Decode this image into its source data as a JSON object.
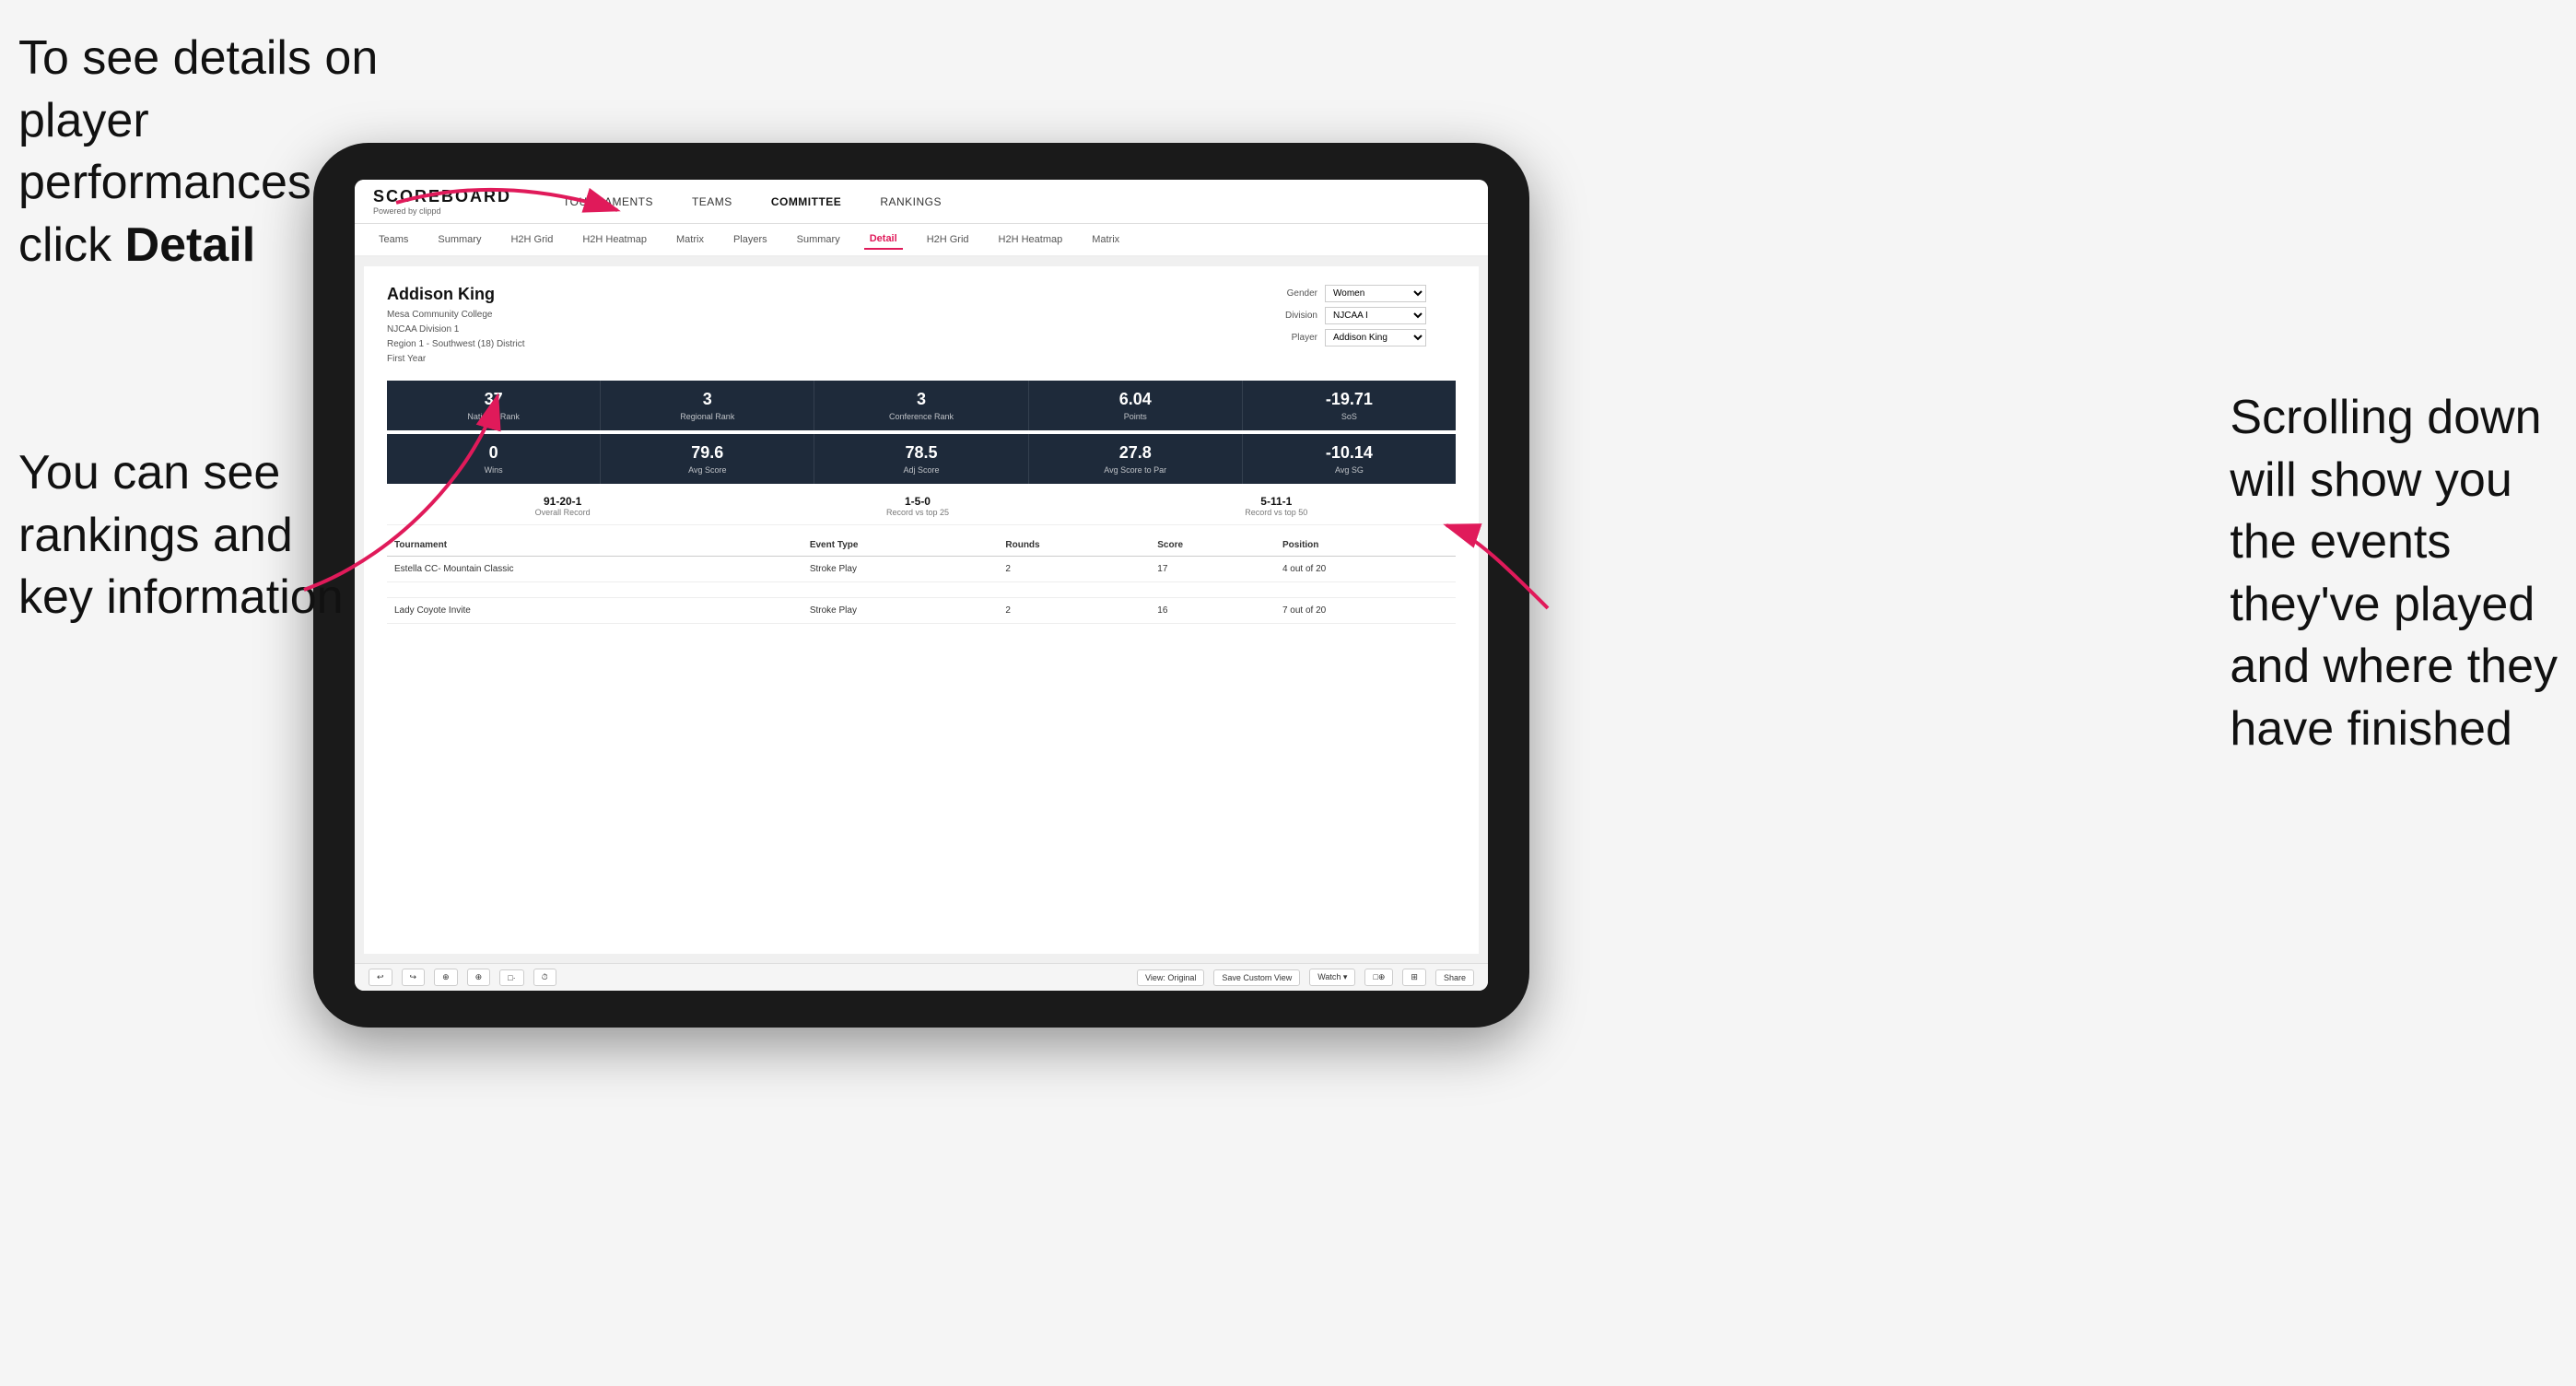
{
  "annotations": {
    "top_left": "To see details on player performances click ",
    "top_left_bold": "Detail",
    "bottom_left_line1": "You can see",
    "bottom_left_line2": "rankings and",
    "bottom_left_line3": "key information",
    "right_line1": "Scrolling down",
    "right_line2": "will show you",
    "right_line3": "the events",
    "right_line4": "they've played",
    "right_line5": "and where they",
    "right_line6": "have finished"
  },
  "nav": {
    "logo": "SCOREBOARD",
    "logo_sub": "Powered by clippd",
    "links": [
      "TOURNAMENTS",
      "TEAMS",
      "COMMITTEE",
      "RANKINGS"
    ]
  },
  "sub_nav": {
    "links": [
      "Teams",
      "Summary",
      "H2H Grid",
      "H2H Heatmap",
      "Matrix",
      "Players",
      "Summary",
      "Detail",
      "H2H Grid",
      "H2H Heatmap",
      "Matrix"
    ],
    "active": "Detail"
  },
  "player": {
    "name": "Addison King",
    "school": "Mesa Community College",
    "division": "NJCAA Division 1",
    "region": "Region 1 - Southwest (18) District",
    "year": "First Year"
  },
  "filters": {
    "gender_label": "Gender",
    "gender_value": "Women",
    "division_label": "Division",
    "division_value": "NJCAA I",
    "player_label": "Player",
    "player_value": "Addison King"
  },
  "stats_row1": [
    {
      "value": "37",
      "label": "National Rank"
    },
    {
      "value": "3",
      "label": "Regional Rank"
    },
    {
      "value": "3",
      "label": "Conference Rank"
    },
    {
      "value": "6.04",
      "label": "Points"
    },
    {
      "value": "-19.71",
      "label": "SoS"
    }
  ],
  "stats_row2": [
    {
      "value": "0",
      "label": "Wins"
    },
    {
      "value": "79.6",
      "label": "Avg Score"
    },
    {
      "value": "78.5",
      "label": "Adj Score"
    },
    {
      "value": "27.8",
      "label": "Avg Score to Par"
    },
    {
      "value": "-10.14",
      "label": "Avg SG"
    }
  ],
  "records": [
    {
      "value": "91-20-1",
      "label": "Overall Record"
    },
    {
      "value": "1-5-0",
      "label": "Record vs top 25"
    },
    {
      "value": "5-11-1",
      "label": "Record vs top 50"
    }
  ],
  "table": {
    "headers": [
      "Tournament",
      "Event Type",
      "Rounds",
      "Score",
      "Position"
    ],
    "rows": [
      {
        "tournament": "Estella CC- Mountain Classic",
        "event_type": "Stroke Play",
        "rounds": "2",
        "score": "17",
        "position": "4 out of 20"
      },
      {
        "tournament": "Lady Coyote Invite",
        "event_type": "Stroke Play",
        "rounds": "2",
        "score": "16",
        "position": "7 out of 20"
      }
    ]
  },
  "toolbar": {
    "buttons": [
      "↩",
      "↪",
      "⊕",
      "⊕",
      "□·",
      "⏱",
      "View: Original",
      "Save Custom View",
      "Watch ▾",
      "□⊕",
      "⊞",
      "Share"
    ]
  }
}
